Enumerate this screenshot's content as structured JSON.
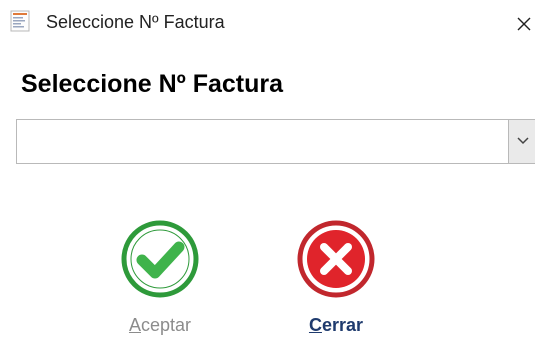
{
  "window": {
    "title": "Seleccione Nº Factura",
    "app_icon": "form-icon",
    "close_icon": "close-icon"
  },
  "heading": "Seleccione Nº Factura",
  "invoice_select": {
    "value": "",
    "dropdown_icon": "chevron-down-icon"
  },
  "actions": {
    "accept": {
      "mnemonic": "A",
      "label_rest": "ceptar",
      "icon": "check-circle-icon",
      "enabled": false,
      "color": "#2e9a3a"
    },
    "close": {
      "mnemonic": "C",
      "label_rest": "errar",
      "icon": "x-circle-icon",
      "enabled": true,
      "color": "#c1272d"
    }
  }
}
